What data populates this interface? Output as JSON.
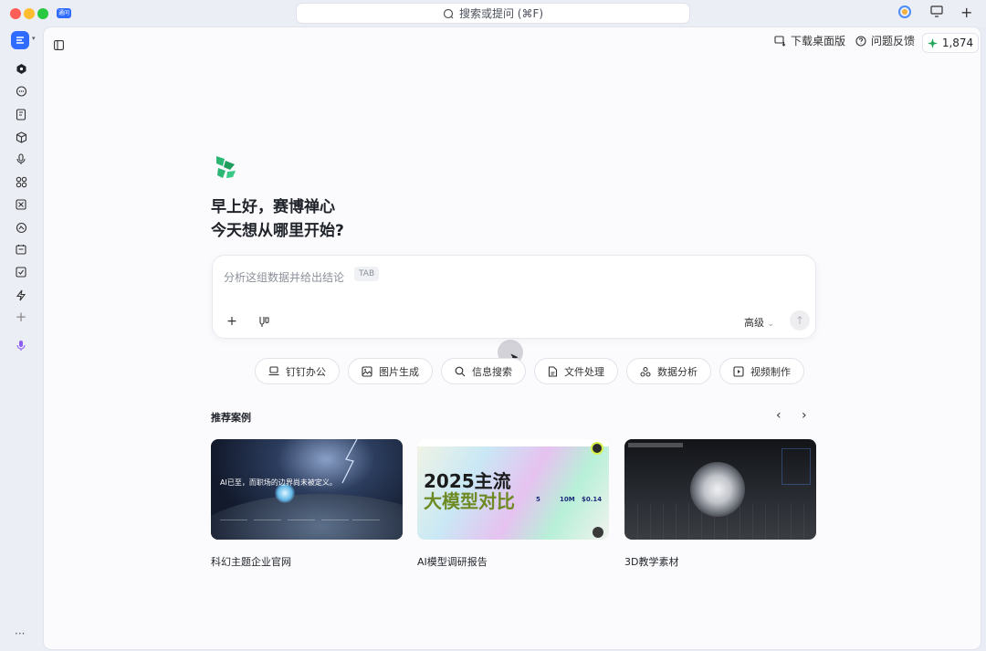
{
  "window": {
    "app_badge": "通问",
    "search_placeholder": "搜索或提问 (⌘F)"
  },
  "header": {
    "download_label": "下载桌面版",
    "feedback_label": "问题反馈",
    "credits": "1,874"
  },
  "greeting": {
    "line1": "早上好，赛博禅心",
    "line2": "今天想从哪里开始?"
  },
  "composer": {
    "placeholder": "分析这组数据并给出结论",
    "tab_hint": "TAB",
    "mode_label": "高级"
  },
  "chips": [
    {
      "label": "钉钉办公",
      "icon": "laptop-icon"
    },
    {
      "label": "图片生成",
      "icon": "image-icon"
    },
    {
      "label": "信息搜索",
      "icon": "search-icon"
    },
    {
      "label": "文件处理",
      "icon": "file-icon"
    },
    {
      "label": "数据分析",
      "icon": "data-icon"
    },
    {
      "label": "视频制作",
      "icon": "video-icon"
    }
  ],
  "examples": {
    "title": "推荐案例",
    "cards": [
      {
        "label": "科幻主题企业官网",
        "headline": "AI已至，而职场的边界尚未被定义。"
      },
      {
        "label": "AI模型调研报告",
        "headline": "2025主流",
        "subline": "大模型对比",
        "stats": [
          "5",
          "10M",
          "$0.14"
        ]
      },
      {
        "label": "3D教学素材"
      }
    ]
  },
  "colors": {
    "accent": "#2f6bff",
    "brand_green": "#2bb673",
    "credit_star": "#22a65a"
  }
}
